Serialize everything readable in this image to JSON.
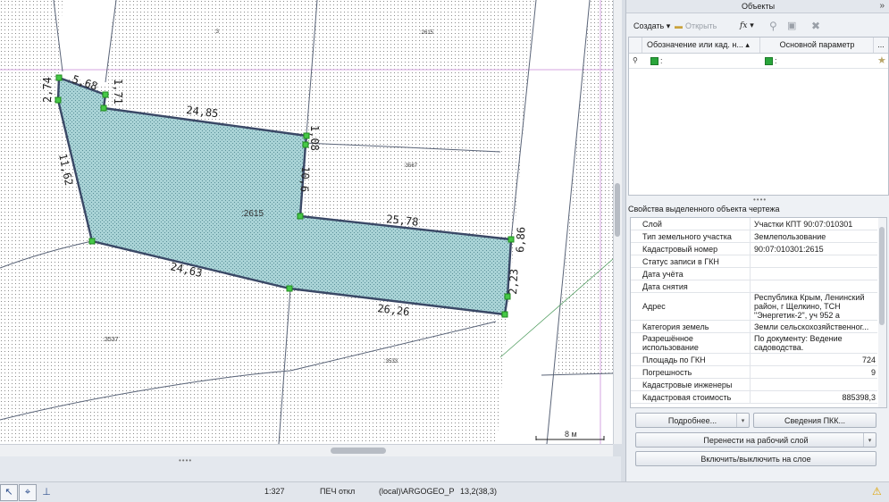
{
  "map": {
    "scale_bar": "8 м",
    "parcel_label": ":2615",
    "edge_labels": [
      "5,68",
      "2,74",
      "1,71",
      "24,85",
      "1,08",
      "10,6",
      "11,62",
      "25,78",
      "6,86",
      "2,23",
      "24,63",
      "26,26"
    ],
    "neighbor_labels": [
      ":2615",
      ":3567",
      ":3537",
      ":3533",
      ":3"
    ]
  },
  "statusbar": {
    "scale": "1:327",
    "print": "ПЕЧ откл",
    "db": "(local)\\ARGOGEO_P",
    "coords": "13,2(38,3)"
  },
  "objects_panel": {
    "title": "Объекты",
    "toolbar": {
      "create": "Создать",
      "open": "Открыть",
      "fx": "fx"
    },
    "columns": [
      "Обозначение или кад. н...",
      "Основной параметр",
      "..."
    ],
    "row": {
      "c1": ":",
      "c2": ":"
    }
  },
  "properties_panel": {
    "title": "Свойства выделенного объекта чертежа",
    "rows": [
      {
        "key": "Слой",
        "value": "Участки КПТ 90:07:010301"
      },
      {
        "key": "Тип земельного участка",
        "value": "Землепользование"
      },
      {
        "key": "Кадастровый номер",
        "value": "90:07:010301:2615"
      },
      {
        "key": "Статус записи в ГКН",
        "value": ""
      },
      {
        "key": "Дата учёта",
        "value": ""
      },
      {
        "key": "Дата снятия",
        "value": ""
      },
      {
        "key": "Адрес",
        "value": "Республика Крым, Ленинский район, г Щелкино, ТСН \"Энергетик-2\", уч 952 а"
      },
      {
        "key": "Категория земель",
        "value": "Земли сельскохозяйственног..."
      },
      {
        "key": "Разрешённое использование",
        "value": "По документу: Ведение садоводства."
      },
      {
        "key": "Площадь по ГКН",
        "value": "724"
      },
      {
        "key": "Погрешность",
        "value": "9"
      },
      {
        "key": "Кадастровые инженеры",
        "value": ""
      },
      {
        "key": "Кадастровая стоимость",
        "value": "885398,3"
      }
    ]
  },
  "buttons": {
    "more": "Подробнее...",
    "pkk": "Сведения ПКК...",
    "move_layer": "Перенести на рабочий слой",
    "toggle_layer": "Включить/выключить на слое"
  },
  "colors": {
    "parcel_fill": "#a9d3d6",
    "parcel_stroke": "#3a4866",
    "vertex": "#46c846",
    "layer_line": "#d4a6e0"
  }
}
